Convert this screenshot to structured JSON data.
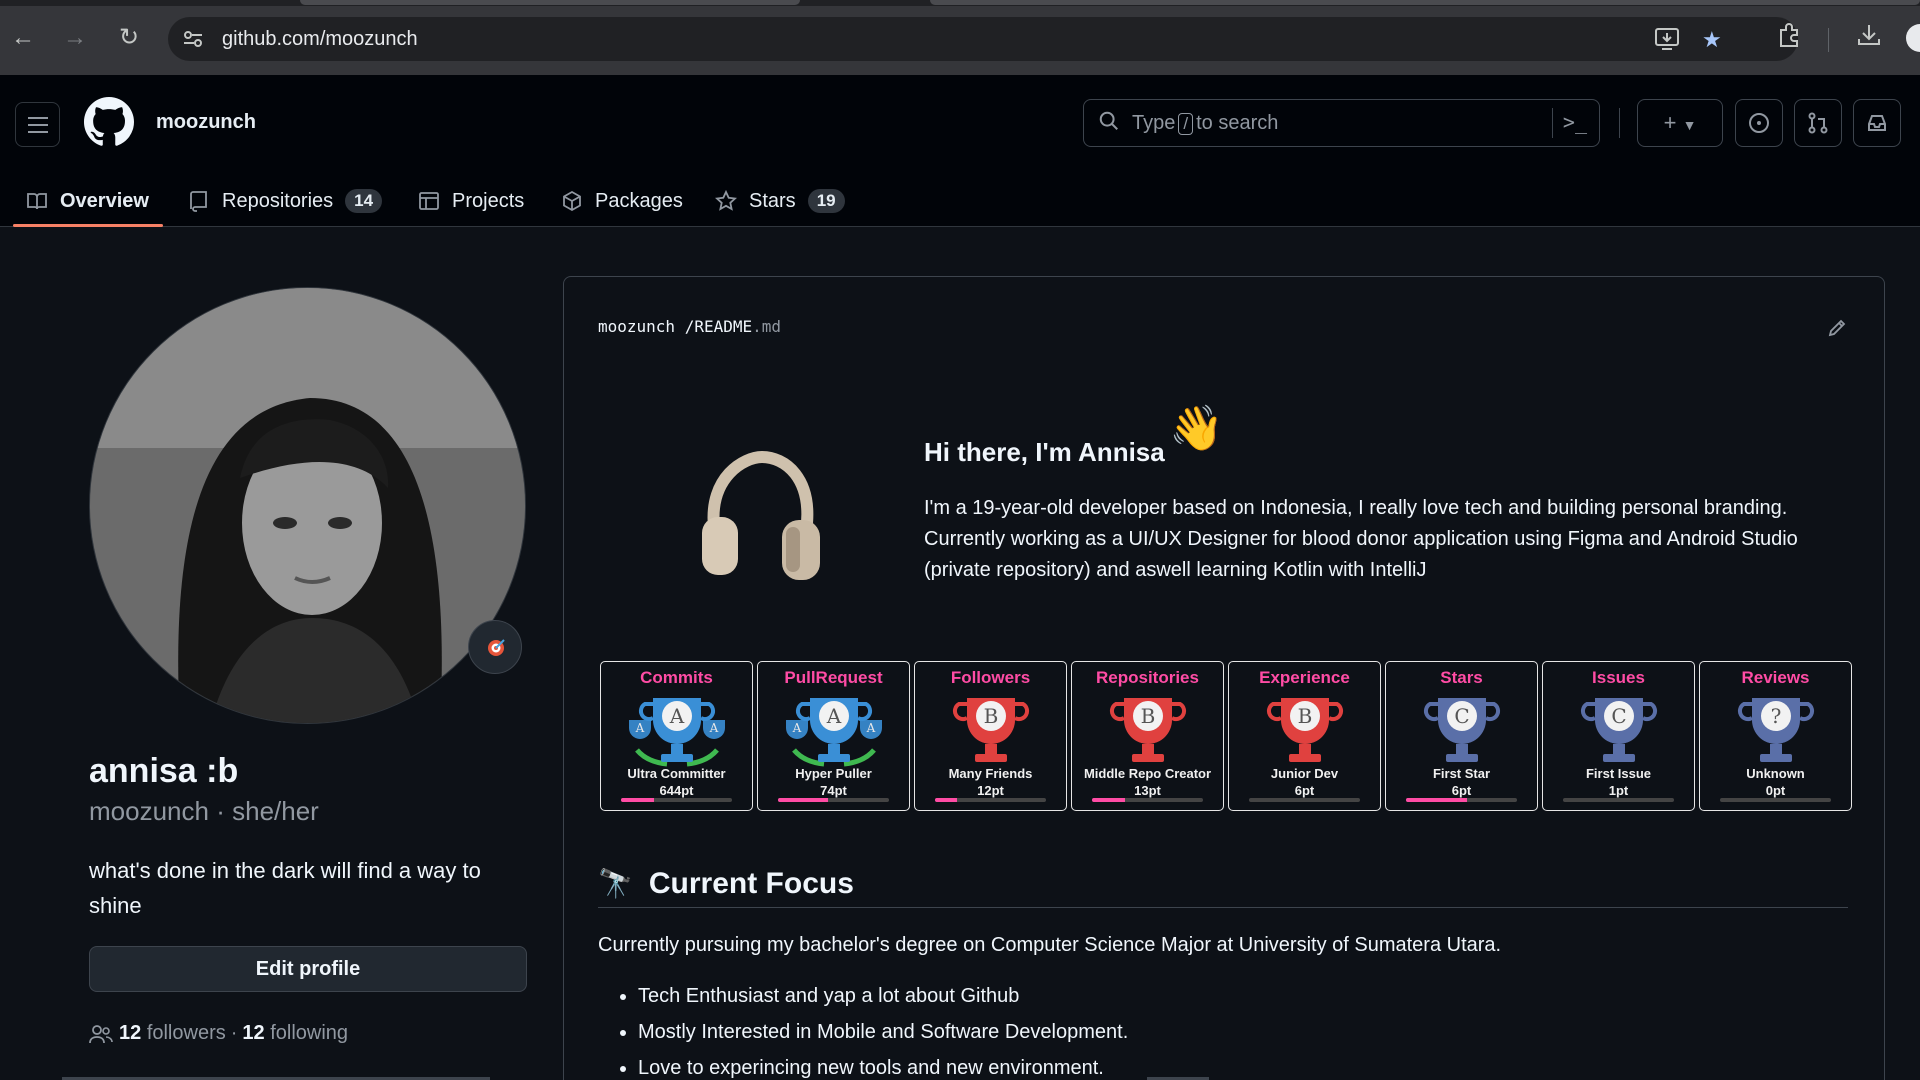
{
  "browser": {
    "url": "github.com/moozunch",
    "back_icon": "arrow-left-icon",
    "forward_icon": "arrow-right-icon",
    "reload_icon": "reload-icon"
  },
  "header": {
    "username": "moozunch",
    "search_prefix": "Type",
    "search_key": "/",
    "search_suffix": "to search"
  },
  "tabs": [
    {
      "label": "Overview",
      "icon": "book-icon"
    },
    {
      "label": "Repositories",
      "icon": "repo-icon",
      "count": "14"
    },
    {
      "label": "Projects",
      "icon": "table-icon"
    },
    {
      "label": "Packages",
      "icon": "package-icon"
    },
    {
      "label": "Stars",
      "icon": "star-icon",
      "count": "19"
    }
  ],
  "profile": {
    "name": "annisa :b",
    "login": "moozunch",
    "pronouns": "she/her",
    "separator": "·",
    "bio": "what's done in the dark will find a way to shine",
    "edit_button": "Edit profile",
    "followers_count": "12",
    "followers_label": "followers",
    "following_count": "12",
    "following_label": "following"
  },
  "readme": {
    "owner": "moozunch",
    "slash": "/",
    "file_name": "README",
    "file_ext": ".md",
    "greeting": "Hi there, I'm Annisa",
    "intro": "I'm a 19-year-old developer based on Indonesia, I really love tech and building personal branding. Currently working as a UI/UX Designer for blood donor application using Figma and Android Studio (private repository) and aswell learning Kotlin with IntelliJ",
    "section_title": "Current Focus",
    "focus_text": "Currently pursuing my bachelor's degree on Computer Science Major at University of Sumatera Utara.",
    "focus_items": [
      "Tech Enthusiast and yap a lot about Github",
      "Mostly Interested in Mobile and Software Development.",
      "Love to experincing new tools and new environment."
    ]
  },
  "trophies": [
    {
      "title": "Commits",
      "rank": "A",
      "name": "Ultra Committer",
      "points": "644pt",
      "progress": 0.3,
      "color": "#3a8fd6"
    },
    {
      "title": "PullRequest",
      "rank": "A",
      "name": "Hyper Puller",
      "points": "74pt",
      "progress": 0.45,
      "color": "#3a8fd6"
    },
    {
      "title": "Followers",
      "rank": "B",
      "name": "Many Friends",
      "points": "12pt",
      "progress": 0.2,
      "color": "#e0413f"
    },
    {
      "title": "Repositories",
      "rank": "B",
      "name": "Middle Repo Creator",
      "points": "13pt",
      "progress": 0.3,
      "color": "#e0413f"
    },
    {
      "title": "Experience",
      "rank": "B",
      "name": "Junior Dev",
      "points": "6pt",
      "progress": 0.0,
      "color": "#e0413f"
    },
    {
      "title": "Stars",
      "rank": "C",
      "name": "First Star",
      "points": "6pt",
      "progress": 0.55,
      "color": "#5a6fa8"
    },
    {
      "title": "Issues",
      "rank": "C",
      "name": "First Issue",
      "points": "1pt",
      "progress": 0.0,
      "color": "#5a6fa8"
    },
    {
      "title": "Reviews",
      "rank": "?",
      "name": "Unknown",
      "points": "0pt",
      "progress": 0.0,
      "color": "#5a6fa8"
    }
  ]
}
